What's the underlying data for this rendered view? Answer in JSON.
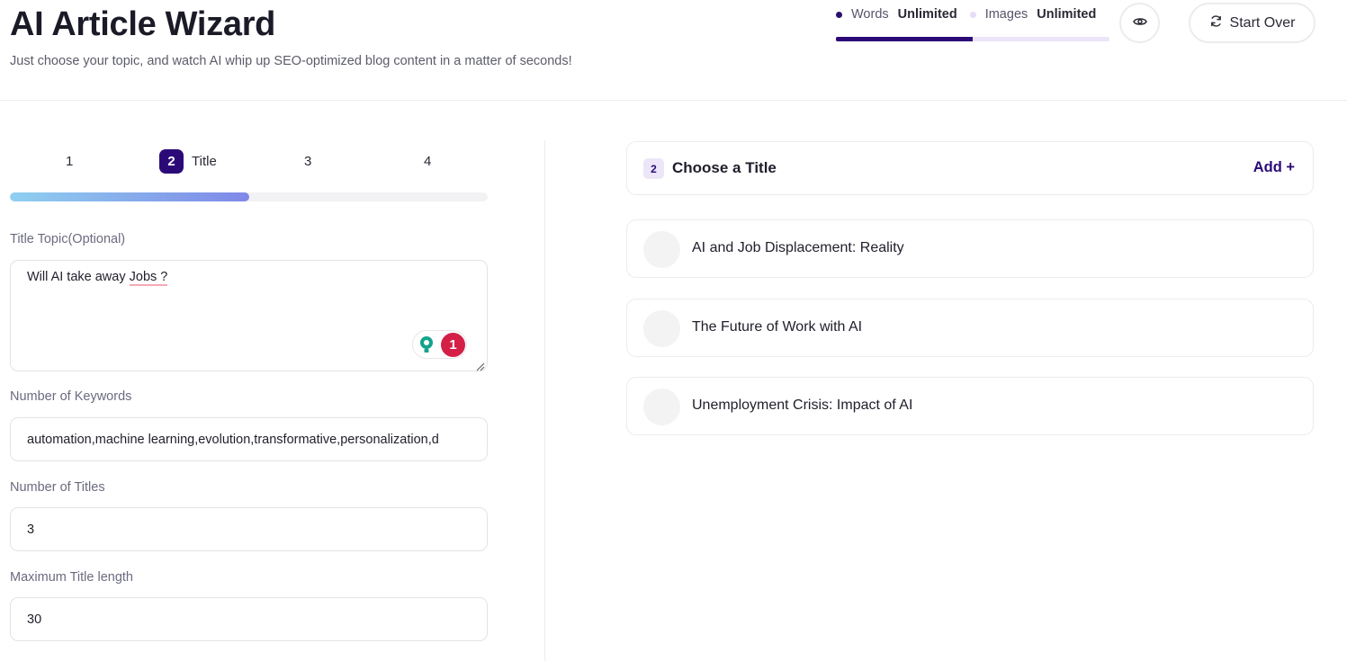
{
  "header": {
    "title": "AI Article Wizard",
    "subtitle": "Just choose your topic, and watch AI whip up SEO-optimized blog content in a matter of seconds!",
    "usage": {
      "words_label": "Words",
      "words_value": "Unlimited",
      "images_label": "Images",
      "images_value": "Unlimited",
      "words_fraction": 0.5
    },
    "start_over_label": "Start Over",
    "accent_color": "#2b0a78"
  },
  "steps": {
    "items": [
      {
        "number": "1",
        "label": ""
      },
      {
        "number": "2",
        "label": "Title"
      },
      {
        "number": "3",
        "label": ""
      },
      {
        "number": "4",
        "label": ""
      }
    ],
    "active_index": 1,
    "progress_fraction": 0.5
  },
  "form": {
    "title_topic_label": "Title Topic(Optional)",
    "title_topic_value_prefix": "Will AI take away ",
    "title_topic_value_flagged": "Jobs ?",
    "grammarly_count": "1",
    "keywords_label": "Number of Keywords",
    "keywords_value": "automation,machine learning,evolution,transformative,personalization,d",
    "titles_label": "Number of Titles",
    "titles_value": "3",
    "max_length_label": "Maximum Title length",
    "max_length_value": "30"
  },
  "titles_panel": {
    "step_number": "2",
    "heading": "Choose a Title",
    "add_label": "Add +",
    "options": [
      "AI and Job Displacement: Reality",
      "The Future of Work with AI",
      "Unemployment Crisis: Impact of AI"
    ]
  }
}
